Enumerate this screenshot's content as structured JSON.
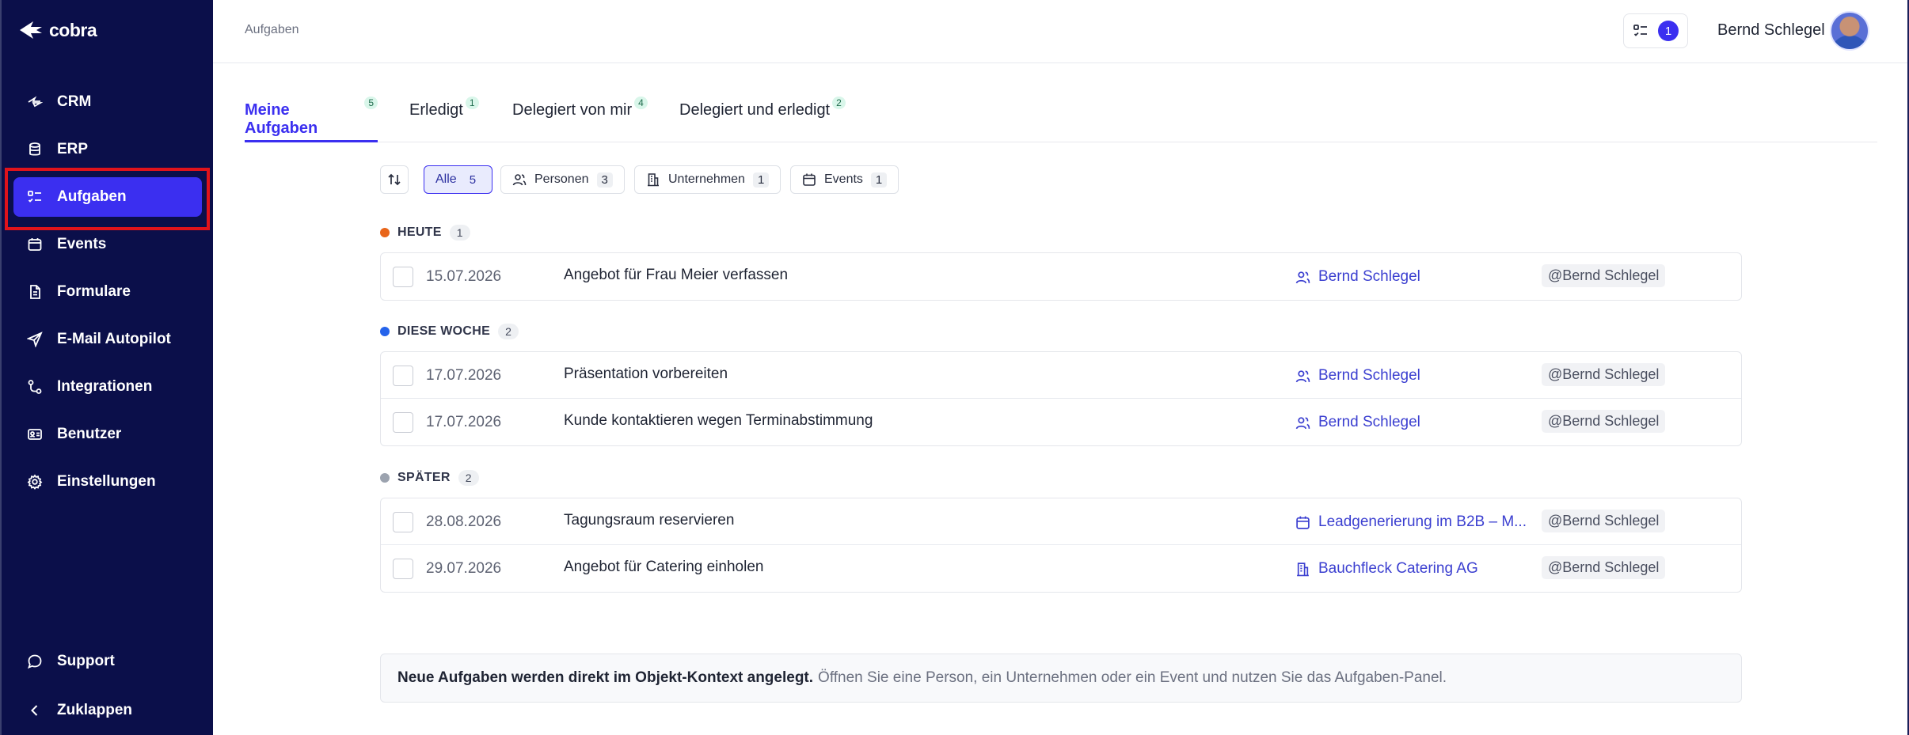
{
  "app": {
    "logo_text": "cobra"
  },
  "sidebar": {
    "items": [
      {
        "label": "CRM",
        "icon": "crm-icon"
      },
      {
        "label": "ERP",
        "icon": "database-icon"
      },
      {
        "label": "Aufgaben",
        "icon": "task-list-icon",
        "active": true
      },
      {
        "label": "Events",
        "icon": "calendar-icon"
      },
      {
        "label": "Formulare",
        "icon": "document-icon"
      },
      {
        "label": "E-Mail Autopilot",
        "icon": "send-icon"
      },
      {
        "label": "Integrationen",
        "icon": "integration-icon"
      },
      {
        "label": "Benutzer",
        "icon": "id-card-icon"
      },
      {
        "label": "Einstellungen",
        "icon": "gear-icon"
      }
    ],
    "support": "Support",
    "collapse": "Zuklappen"
  },
  "header": {
    "breadcrumb": "Aufgaben",
    "task_count": "1",
    "user_name": "Bernd Schlegel"
  },
  "tabs": [
    {
      "label": "Meine Aufgaben",
      "count": "5",
      "active": true
    },
    {
      "label": "Erledigt",
      "count": "1"
    },
    {
      "label": "Delegiert von mir",
      "count": "4"
    },
    {
      "label": "Delegiert und erledigt",
      "count": "2"
    }
  ],
  "filters": [
    {
      "label": "Alle",
      "count": "5",
      "active": true
    },
    {
      "label": "Personen",
      "count": "3",
      "icon": "people-icon"
    },
    {
      "label": "Unternehmen",
      "count": "1",
      "icon": "building-icon"
    },
    {
      "label": "Events",
      "count": "1",
      "icon": "calendar-icon"
    }
  ],
  "groups": [
    {
      "label": "HEUTE",
      "count": "1",
      "color": "#e8651a",
      "tasks": [
        {
          "date": "15.07.2026",
          "title": "Angebot für Frau Meier verfassen",
          "link": "Bernd Schlegel",
          "link_icon": "people-icon",
          "assignee": "@Bernd Schlegel"
        }
      ]
    },
    {
      "label": "DIESE WOCHE",
      "count": "2",
      "color": "#2563eb",
      "tasks": [
        {
          "date": "17.07.2026",
          "title": "Präsentation vorbereiten",
          "link": "Bernd Schlegel",
          "link_icon": "people-icon",
          "assignee": "@Bernd Schlegel"
        },
        {
          "date": "17.07.2026",
          "title": "Kunde kontaktieren wegen Terminabstimmung",
          "link": "Bernd Schlegel",
          "link_icon": "people-icon",
          "assignee": "@Bernd Schlegel"
        }
      ]
    },
    {
      "label": "SPÄTER",
      "count": "2",
      "color": "#9ca3af",
      "tasks": [
        {
          "date": "28.08.2026",
          "title": "Tagungsraum reservieren",
          "link": "Leadgenerierung im B2B – M...",
          "link_icon": "calendar-icon",
          "assignee": "@Bernd Schlegel"
        },
        {
          "date": "29.07.2026",
          "title": "Angebot für Catering einholen",
          "link": "Bauchfleck Catering AG",
          "link_icon": "building-icon",
          "assignee": "@Bernd Schlegel"
        }
      ]
    }
  ],
  "hint": {
    "bold": "Neue Aufgaben werden direkt im Objekt-Kontext angelegt.",
    "text": "Öffnen Sie eine Person, ein Unternehmen oder ein Event und nutzen Sie das Aufgaben-Panel."
  },
  "colors": {
    "sidebar": "#0b0f4a",
    "accent": "#3b2ff0",
    "link": "#3b3fd0",
    "highlight": "#e0131b"
  }
}
